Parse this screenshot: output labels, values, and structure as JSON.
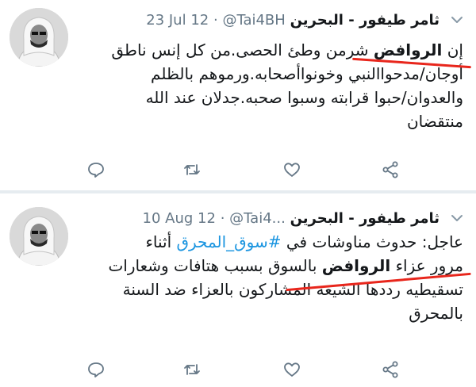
{
  "tweets": [
    {
      "author_name": "ثامر طيفور - البحرين",
      "handle": "@Tai4BH",
      "separator": "·",
      "date": "23 Jul 12",
      "lines": [
        {
          "before": "إن ",
          "highlight": "الروافض",
          "after": " شرمن وطئ الحصى.من كل إنس ناطق"
        },
        {
          "text": "أوجان/مدحواالنبي وخونواأصحابه.ورموهم بالظلم"
        },
        {
          "text": "والعدوان/حبوا قرابته وسبوا صحبه.جدلان عند الله"
        },
        {
          "text": "منتقضان"
        }
      ]
    },
    {
      "author_name": "ثامر طيفور - البحرين",
      "handle": "@Tai4...",
      "separator": "·",
      "date": "10 Aug 12",
      "lines": [
        {
          "before": "عاجل: حدوث مناوشات في ",
          "tag": "#سوق_المحرق",
          "after": " أثناء"
        },
        {
          "before": "مرور عزاء ",
          "highlight": "الروافض",
          "after": " بالسوق بسبب هتافات وشعارات"
        },
        {
          "text": "تسقيطيه رددها الشيعة المشاركون بالعزاء ضد السنة"
        },
        {
          "text": "بالمحرق"
        }
      ]
    }
  ],
  "icons": {
    "reply": "reply-icon",
    "retweet": "retweet-icon",
    "like": "heart-icon",
    "share": "share-icon",
    "menu": "chevron-down-icon"
  },
  "colors": {
    "text": "#14171a",
    "muted": "#657786",
    "hashtag": "#1b95e0",
    "annotation": "#e8261c",
    "divider": "#e6ecf0"
  }
}
